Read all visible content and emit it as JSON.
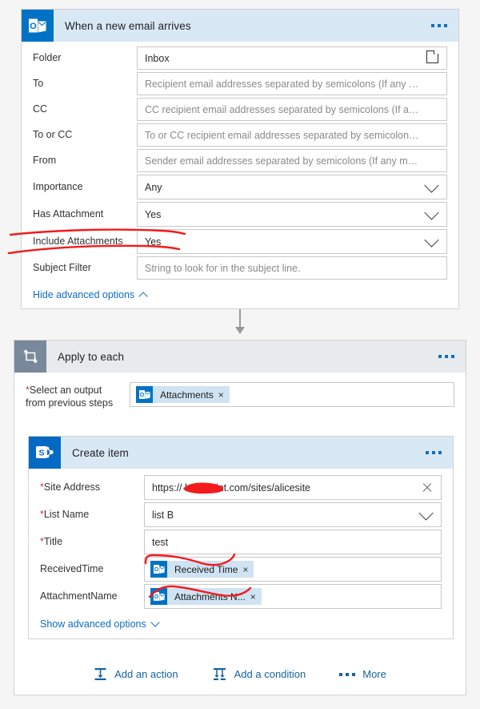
{
  "flow": {
    "trigger": {
      "title": "When a new email arrives",
      "icon": "outlook-icon",
      "menu": "more-options",
      "fields": [
        {
          "label": "Folder",
          "type": "text-picker",
          "value": "Inbox",
          "icon": "folder-icon"
        },
        {
          "label": "To",
          "type": "text",
          "placeholder": "Recipient email addresses separated by semicolons (If any match, the trigger ..."
        },
        {
          "label": "CC",
          "type": "text",
          "placeholder": "CC recipient email addresses separated by semicolons (If any match, the trigg..."
        },
        {
          "label": "To or CC",
          "type": "text",
          "placeholder": "To or CC recipient email addresses separated by semicolons (If any match, th..."
        },
        {
          "label": "From",
          "type": "text",
          "placeholder": "Sender email addresses separated by semicolons (If any match, the trigger wi..."
        },
        {
          "label": "Importance",
          "type": "dropdown",
          "value": "Any"
        },
        {
          "label": "Has Attachment",
          "type": "dropdown",
          "value": "Yes"
        },
        {
          "label": "Include Attachments",
          "type": "dropdown",
          "value": "Yes",
          "annotated": true
        },
        {
          "label": "Subject Filter",
          "type": "text",
          "placeholder": "String to look for in the subject line."
        }
      ],
      "advanced_link": "Hide advanced options"
    },
    "loop": {
      "title": "Apply to each",
      "icon": "loop-icon",
      "menu": "more-options",
      "select_label_line1": "Select an output",
      "select_label_line2": "from previous steps",
      "required_marker": "*",
      "token": {
        "label": "Attachments",
        "close": "×",
        "icon": "outlook-icon"
      }
    },
    "action": {
      "title": "Create item",
      "icon": "sharepoint-icon",
      "menu": "more-options",
      "fields": [
        {
          "label": "Site Address",
          "required": true,
          "type": "text-clear",
          "value": "https://                 harepoint.com/sites/alicesite",
          "value_prefix": "https:/",
          "value_suffix": "harepoint.com/sites/alicesite",
          "redacted": true
        },
        {
          "label": "List Name",
          "required": true,
          "type": "dropdown",
          "value": "list B"
        },
        {
          "label": "Title",
          "required": true,
          "type": "text",
          "value": "test"
        },
        {
          "label": "ReceivedTime",
          "required": false,
          "type": "token",
          "token": {
            "label": "Received Time",
            "close": "×",
            "icon": "outlook-icon"
          },
          "annotated": true
        },
        {
          "label": "AttachmentName",
          "required": false,
          "type": "token",
          "token": {
            "label": "Attachments N...",
            "close": "×",
            "icon": "outlook-icon"
          },
          "annotated": true
        }
      ],
      "advanced_link": "Show advanced options"
    },
    "actionbar": {
      "add_action": "Add an action",
      "add_condition": "Add a condition",
      "more": "More"
    }
  },
  "colors": {
    "header_blue": "#d9e8f5",
    "header_gray": "#e7ebee",
    "outlook_blue": "#0072c6",
    "sharepoint_blue": "#036ac4",
    "loop_gray": "#79899b",
    "link_blue": "#0f6cbd",
    "annotation_red": "#f31b1b",
    "token_blue": "#cfe3f3",
    "page_bg": "#f5f5f5"
  }
}
